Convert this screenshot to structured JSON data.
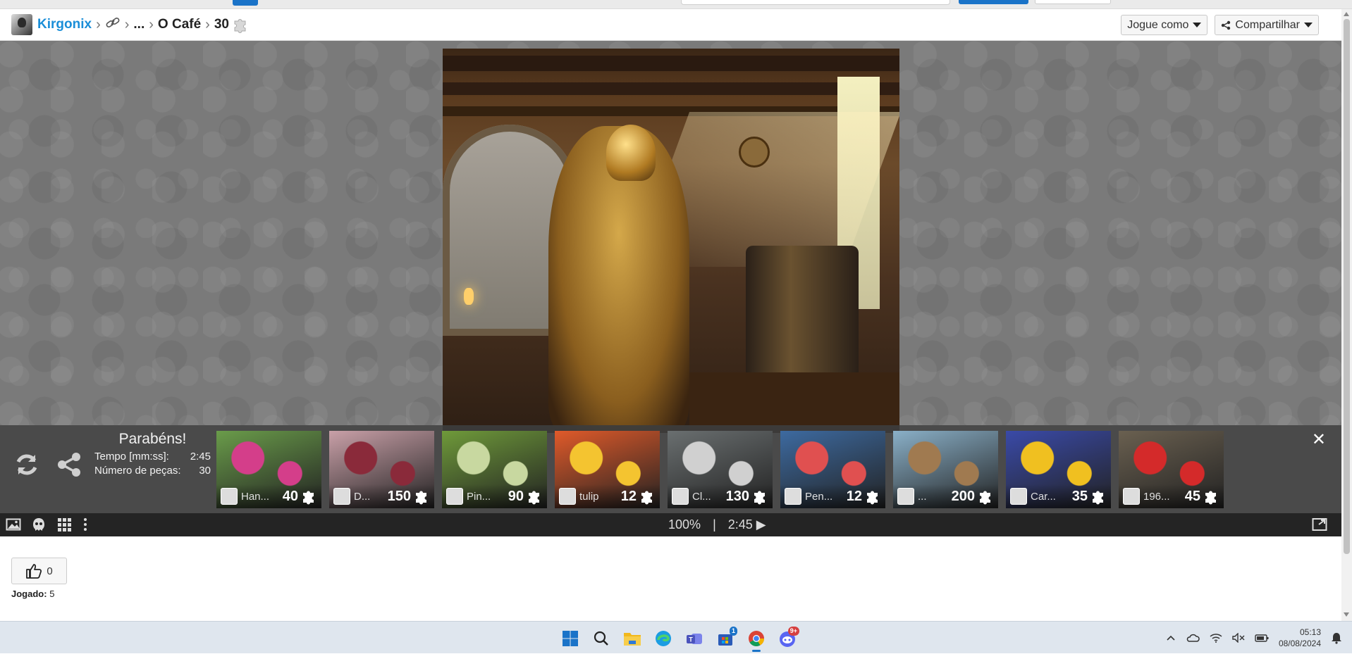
{
  "header": {
    "user": "Kirgonix",
    "dots": "...",
    "title": "O Café",
    "piece_count": "30",
    "play_as_label": "Jogue como",
    "share_label": "Compartilhar"
  },
  "result": {
    "title": "Parabéns!",
    "time_label": "Tempo [mm:ss]:",
    "time_value": "2:45",
    "pieces_label": "Número de peças:",
    "pieces_value": "30"
  },
  "thumbnails": [
    {
      "name": "Han...",
      "count": "40",
      "bg": "#6a9c4a",
      "accent": "#d43e8a"
    },
    {
      "name": "D...",
      "count": "150",
      "bg": "#c9a0a8",
      "accent": "#8a2a3a"
    },
    {
      "name": "Pin...",
      "count": "90",
      "bg": "#6f9a3a",
      "accent": "#c8d8a0"
    },
    {
      "name": "tulip",
      "count": "12",
      "bg": "#e05a2a",
      "accent": "#f4c430"
    },
    {
      "name": "Cl...",
      "count": "130",
      "bg": "#6a6f70",
      "accent": "#d0d0d0"
    },
    {
      "name": "Pen...",
      "count": "12",
      "bg": "#3d6aa0",
      "accent": "#e05050"
    },
    {
      "name": "...",
      "count": "200",
      "bg": "#8ab0c8",
      "accent": "#a07a50"
    },
    {
      "name": "Car...",
      "count": "35",
      "bg": "#3a4aa8",
      "accent": "#f0c020"
    },
    {
      "name": "196...",
      "count": "45",
      "bg": "#6a6050",
      "accent": "#d42a2a"
    }
  ],
  "controls": {
    "zoom": "100%",
    "separator": "|",
    "timer": "2:45 ▶"
  },
  "page": {
    "likes": "0",
    "played_label": "Jogado:",
    "played_value": "5"
  },
  "taskbar": {
    "apps": [
      "windows-start",
      "search",
      "file-explorer",
      "edge",
      "teams",
      "store",
      "chrome",
      "discord"
    ],
    "teams_badge": "1",
    "discord_badge": "9+",
    "time": "05:13",
    "date": "08/08/2024"
  },
  "colors": {
    "link_blue": "#1a8ed8",
    "panel_bg": "#3c3c3c",
    "control_bar": "#242424",
    "stage_gray": "#7a7a7a"
  }
}
